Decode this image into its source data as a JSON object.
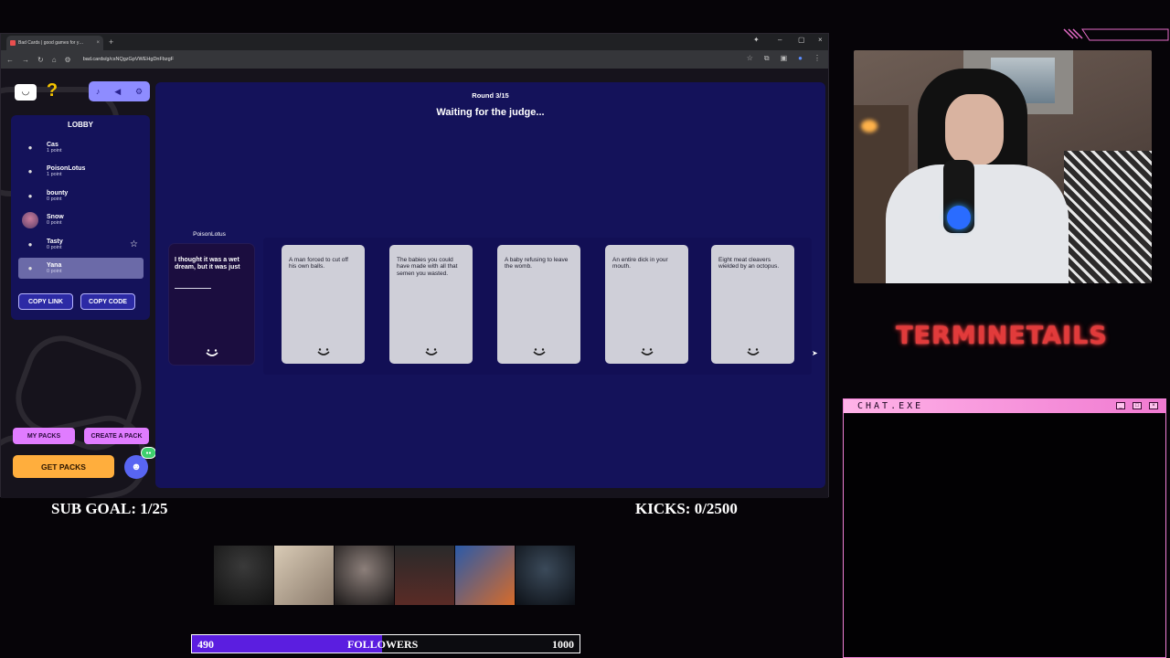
{
  "browser": {
    "tab_title": "Bad Cards | good games for y…",
    "url": "bad.cards/g/csNQgzGpVWEHgDnFbzgF"
  },
  "lobby": {
    "title": "LOBBY",
    "players": [
      {
        "name": "Cas",
        "points": "1 point"
      },
      {
        "name": "PoisonLotus",
        "points": "1 point"
      },
      {
        "name": "bounty",
        "points": "0 point"
      },
      {
        "name": "Snow",
        "points": "0 point"
      },
      {
        "name": "Tasty",
        "points": "0 point"
      },
      {
        "name": "Yana",
        "points": "0 point"
      }
    ],
    "copy_link": "COPY LINK",
    "copy_code": "COPY CODE"
  },
  "packs": {
    "my_packs": "MY PACKS",
    "create_pack": "CREATE A PACK",
    "get_packs": "GET PACKS"
  },
  "game": {
    "round": "Round 3/15",
    "status": "Waiting for the judge...",
    "question_owner": "PoisonLotus",
    "question_text": "I thought it was a wet dream, but it was just",
    "answers": [
      "A man forced to cut off his own balls.",
      "The babies you could have made with all that semen you wasted.",
      "A baby refusing to leave the womb.",
      "An entire dick in your mouth.",
      "Eight meat cleavers wielded by an octopus."
    ]
  },
  "overlay": {
    "brand": "TERMINETAILS",
    "chat_title": "CHAT.EXE",
    "sub_goal": "SUB GOAL: 1/25",
    "kicks": "KICKS: 0/2500",
    "followers_current": "490",
    "followers_label": "FOLLOWERS",
    "followers_target": "1000",
    "followers_progress": 0.49
  },
  "colors": {
    "board": "#14125a",
    "accent_pink": "#e07cff",
    "accent_orange": "#ffae3d",
    "chat_border": "#ef7fd5",
    "follower_fill": "#5b1ee0"
  }
}
